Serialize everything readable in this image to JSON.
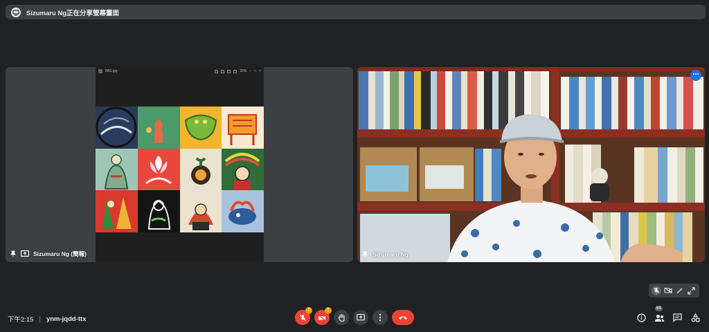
{
  "banner": {
    "text": "Sizumaru Ng正在分享螢幕畫面",
    "icon": "presenting-icon"
  },
  "shared_window": {
    "filename": "IMG.jpg",
    "zoom": "35%"
  },
  "participants": [
    {
      "name": "Sizumaru Ng (簡報)",
      "role": "presentation"
    },
    {
      "name": "Sizumaru Ng",
      "role": "camera"
    }
  ],
  "meeting": {
    "time": "下午2:15",
    "separator": "|",
    "code": "ynm-jqdd-ttx"
  },
  "controls": {
    "mic": {
      "icon": "mic-off-icon",
      "warning": "!"
    },
    "camera": {
      "icon": "camera-off-icon",
      "warning": "!"
    },
    "hand": {
      "icon": "raise-hand-icon"
    },
    "present": {
      "icon": "present-icon"
    },
    "more": {
      "icon": "more-vert-icon"
    },
    "leave": {
      "icon": "hangup-icon"
    }
  },
  "right_controls": {
    "people_count": "64"
  },
  "colors": {
    "background": "#202124",
    "surface": "#3c4043",
    "accent": "#1a73e8",
    "danger": "#ea4335",
    "warning": "#f29900"
  }
}
